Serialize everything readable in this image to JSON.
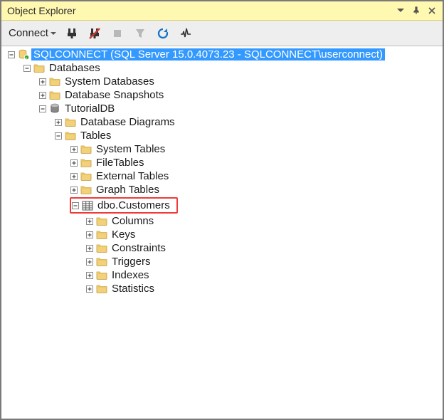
{
  "titlebar": {
    "title": "Object Explorer"
  },
  "toolbar": {
    "connect_label": "Connect",
    "refresh_color": "#1573c9",
    "plug_red": "#cc3b2e"
  },
  "tree": {
    "server_label": "SQLCONNECT (SQL Server 15.0.4073.23 - SQLCONNECT\\userconnect)",
    "databases_label": "Databases",
    "sys_db_label": "System Databases",
    "snapshots_label": "Database Snapshots",
    "tutorialdb_label": "TutorialDB",
    "diagrams_label": "Database Diagrams",
    "tables_label": "Tables",
    "system_tables_label": "System Tables",
    "file_tables_label": "FileTables",
    "external_tables_label": "External Tables",
    "graph_tables_label": "Graph Tables",
    "dbo_customers_label": "dbo.Customers",
    "columns_label": "Columns",
    "keys_label": "Keys",
    "constraints_label": "Constraints",
    "triggers_label": "Triggers",
    "indexes_label": "Indexes",
    "statistics_label": "Statistics"
  },
  "colors": {
    "selection_bg": "#3399ff",
    "titlebar_bg": "#fff8b0",
    "highlight_border": "#ef3a3a"
  }
}
